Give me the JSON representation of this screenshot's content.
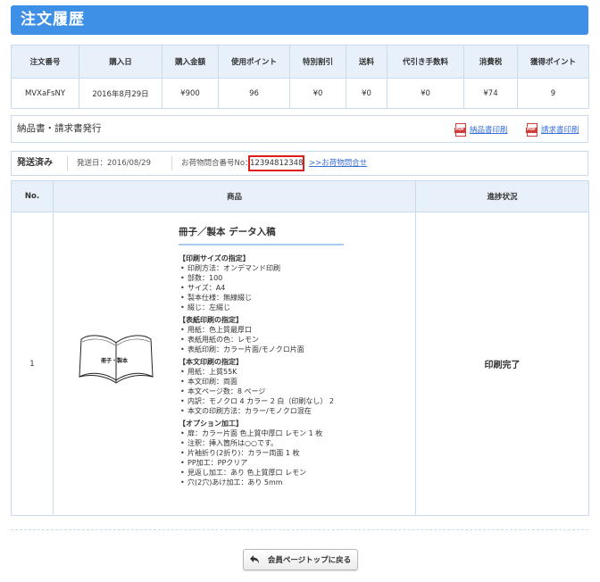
{
  "page_title": "注文履歴",
  "summary": {
    "headers": [
      "注文番号",
      "購入日",
      "購入金額",
      "使用ポイント",
      "特別割引",
      "送料",
      "代引き手数料",
      "消費税",
      "獲得ポイント"
    ],
    "row": [
      "MVXaFsNY",
      "2016年8月29日",
      "¥900",
      "96",
      "¥0",
      "¥0",
      "¥0",
      "¥74",
      "9"
    ]
  },
  "documents": {
    "title": "納品書・請求書発行",
    "delivery_link": "納品書印刷",
    "invoice_link": "請求書印刷"
  },
  "shipping": {
    "status": "発送済み",
    "date": "発送日：2016/08/29",
    "tracking_label": "お荷物問合番号No：",
    "tracking_number": "12394812348",
    "tracking_link": ">>お荷物問合せ"
  },
  "items_table": {
    "headers": {
      "no": "No.",
      "product": "商品",
      "progress": "進捗状況"
    },
    "rows": [
      {
        "no": "1",
        "image_label": "冊子・製本",
        "product_title": "冊子／製本 データ入稿",
        "sections": [
          {
            "heading": "【印刷サイズの指定】",
            "items": [
              "印刷方法：オンデマンド印刷",
              "部数：100",
              "サイズ：A4",
              "製本仕様：無線綴じ",
              "綴じ：左綴じ"
            ]
          },
          {
            "heading": "【表紙印刷の指定】",
            "items": [
              "用紙：色上質最厚口",
              "表紙用紙の色：レモン",
              "表紙印刷：カラー片面/モノクロ片面"
            ]
          },
          {
            "heading": "【本文印刷の指定】",
            "items": [
              "用紙：上質55K",
              "本文印刷：両面",
              "本文ページ数：8 ページ",
              "内訳：モノクロ 4 カラー 2 白（印刷なし） 2",
              "本文の印刷方法：カラー/モノクロ混在"
            ]
          },
          {
            "heading": "【オプション加工】",
            "items": [
              "扉：カラー片面 色上質中厚口 レモン 1 枚",
              "注釈：挿入箇所は○○です。",
              "片袖折り(2折り)：カラー両面 1 枚",
              "PP加工：PPクリア",
              "見返し加工：あり 色上質厚口 レモン",
              "穴(2穴)あけ加工：あり 5mm"
            ]
          }
        ],
        "status": "印刷完了"
      }
    ]
  },
  "back_button": "会員ページトップに戻る",
  "colors": {
    "header_blue": "#3e8fe6",
    "table_header_bg": "#e8f1fa",
    "border": "#c9dcee",
    "highlight_red": "#e01b1b",
    "link": "#3a6fd8"
  }
}
